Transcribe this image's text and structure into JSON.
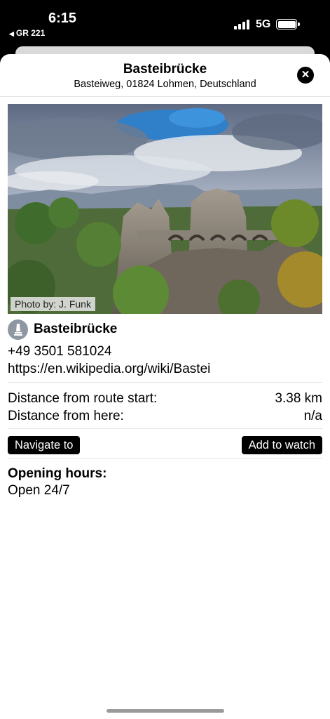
{
  "status_bar": {
    "time": "6:15",
    "back_app": "GR 221",
    "network": "5G",
    "battery_level": 1.0,
    "signal_bars": 4
  },
  "sheet": {
    "title": "Basteibrücke",
    "address": "Basteiweg, 01824 Lohmen, Deutschland",
    "close_icon": "close-icon"
  },
  "photo": {
    "credit": "Photo by: J. Funk"
  },
  "poi": {
    "icon": "monument-icon",
    "name": "Basteibrücke",
    "phone": "+49 3501 581024",
    "website": "https://en.wikipedia.org/wiki/Bastei"
  },
  "distances": [
    {
      "label": "Distance from route start:",
      "value": "3.38 km"
    },
    {
      "label": "Distance from here:",
      "value": "n/a"
    }
  ],
  "actions": {
    "navigate": "Navigate to",
    "watch": "Add to watch"
  },
  "hours": {
    "title": "Opening hours:",
    "value": "Open 24/7"
  },
  "colors": {
    "button_bg": "#000000",
    "poi_icon_bg": "#8e97a2",
    "divider": "#e3e3e3"
  }
}
